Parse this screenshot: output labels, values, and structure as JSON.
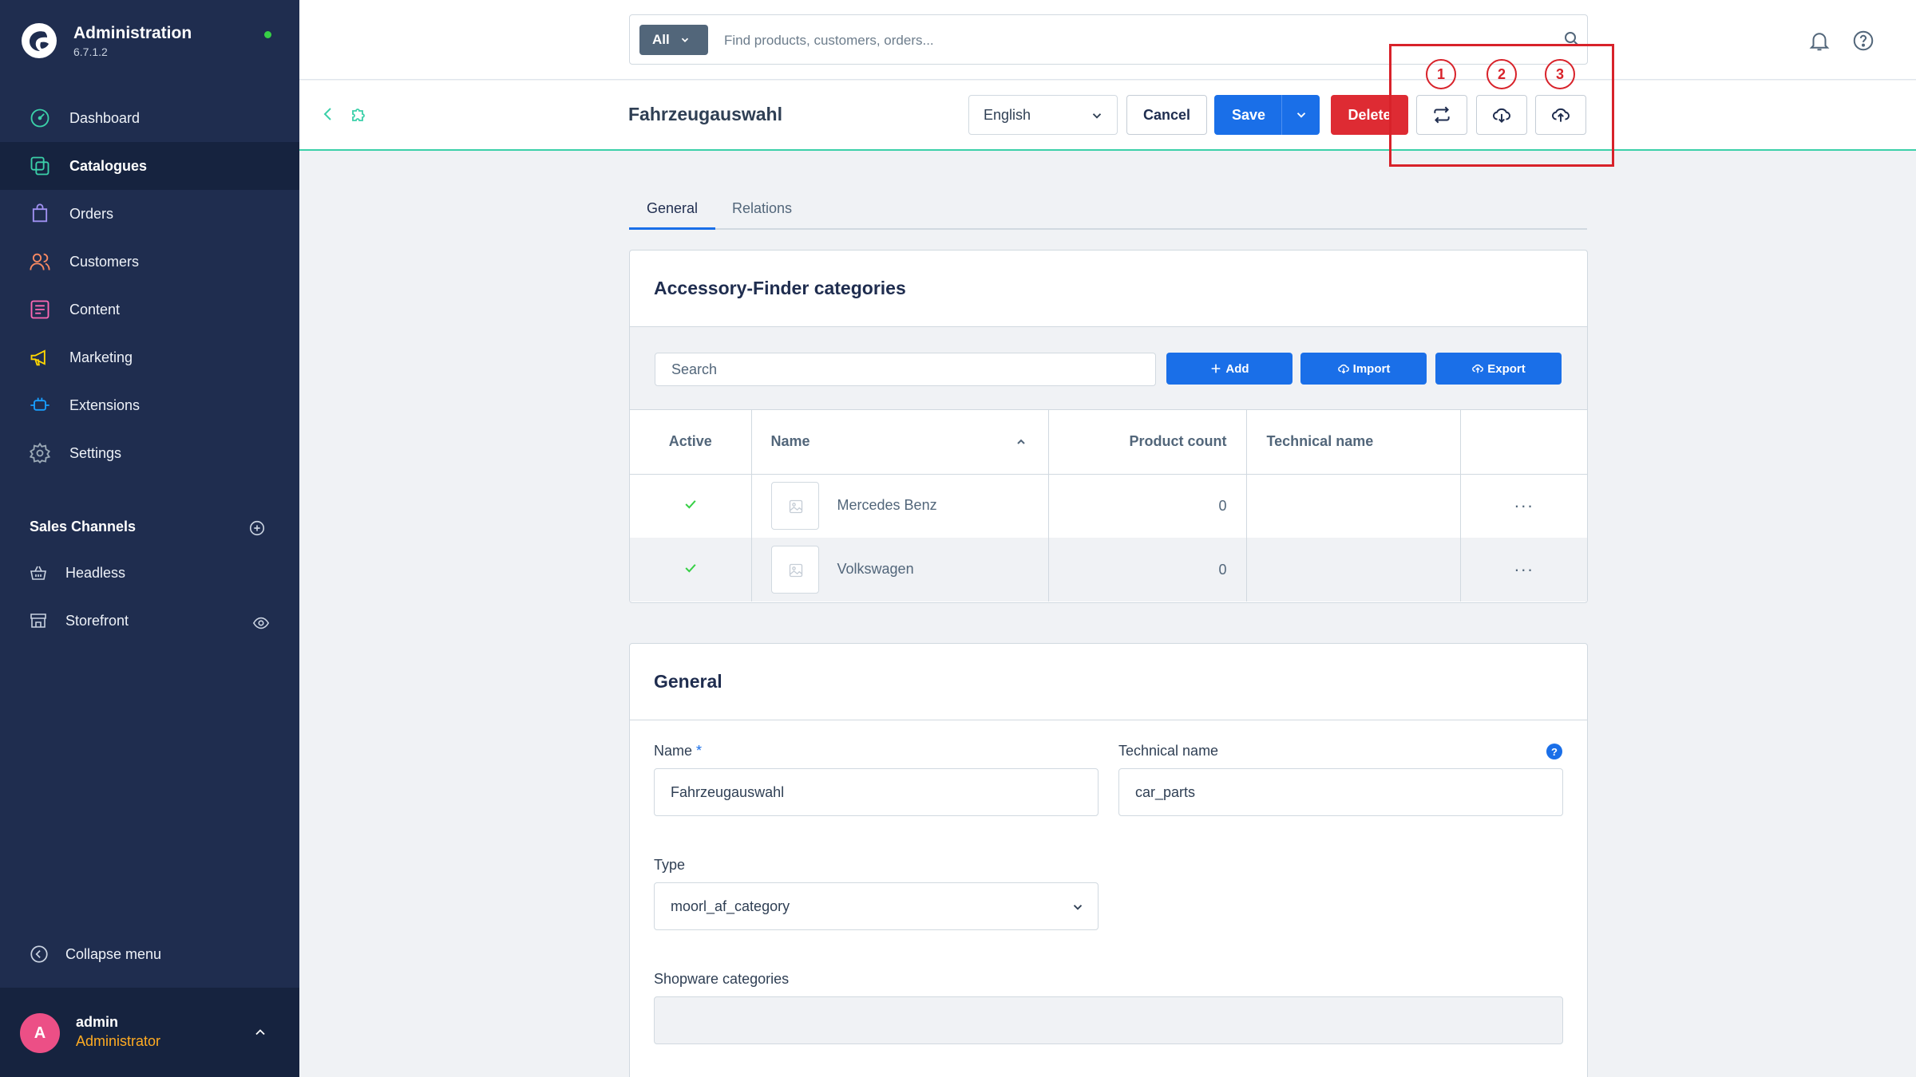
{
  "app": {
    "title": "Administration",
    "version": "6.7.1.2"
  },
  "sidebar": {
    "items": [
      {
        "label": "Dashboard",
        "icon": "dashboard-icon",
        "active": false
      },
      {
        "label": "Catalogues",
        "icon": "catalogues-icon",
        "active": true
      },
      {
        "label": "Orders",
        "icon": "orders-icon",
        "active": false
      },
      {
        "label": "Customers",
        "icon": "customers-icon",
        "active": false
      },
      {
        "label": "Content",
        "icon": "content-icon",
        "active": false
      },
      {
        "label": "Marketing",
        "icon": "marketing-icon",
        "active": false
      },
      {
        "label": "Extensions",
        "icon": "extensions-icon",
        "active": false
      },
      {
        "label": "Settings",
        "icon": "settings-icon",
        "active": false
      }
    ],
    "sales_channels_title": "Sales Channels",
    "channels": [
      {
        "label": "Headless",
        "icon": "basket-icon"
      },
      {
        "label": "Storefront",
        "icon": "storefront-icon"
      }
    ],
    "collapse_label": "Collapse menu",
    "user": {
      "initial": "A",
      "name": "admin",
      "role": "Administrator"
    }
  },
  "search": {
    "scope": "All",
    "placeholder": "Find products, customers, orders..."
  },
  "smartbar": {
    "title": "Fahrzeugauswahl",
    "language": "English",
    "cancel_label": "Cancel",
    "save_label": "Save",
    "delete_label": "Delete"
  },
  "annotations": [
    "1",
    "2",
    "3"
  ],
  "tabs": [
    {
      "label": "General",
      "active": true
    },
    {
      "label": "Relations",
      "active": false
    }
  ],
  "categories_card": {
    "title": "Accessory-Finder categories",
    "search_placeholder": "Search",
    "add_label": "Add",
    "import_label": "Import",
    "export_label": "Export",
    "columns": {
      "active": "Active",
      "name": "Name",
      "product_count": "Product count",
      "technical_name": "Technical name"
    },
    "rows": [
      {
        "name": "Mercedes Benz",
        "product_count": "0",
        "technical_name": "",
        "actions": "···"
      },
      {
        "name": "Volkswagen",
        "product_count": "0",
        "technical_name": "",
        "actions": "···"
      }
    ]
  },
  "general_card": {
    "title": "General",
    "name_label": "Name",
    "required_mark": "*",
    "name_value": "Fahrzeugauswahl",
    "technical_name_label": "Technical name",
    "technical_name_value": "car_parts",
    "help_glyph": "?",
    "type_label": "Type",
    "type_value": "moorl_af_category",
    "shopware_categories_label": "Shopware categories",
    "shopware_categories_value": ""
  },
  "colors": {
    "sidebar": "#1f2d4f",
    "primary": "#1a6fe8",
    "danger": "#de2b33",
    "accent": "#3bd0a9",
    "annotation": "#d8222a",
    "role": "#ffab22"
  }
}
